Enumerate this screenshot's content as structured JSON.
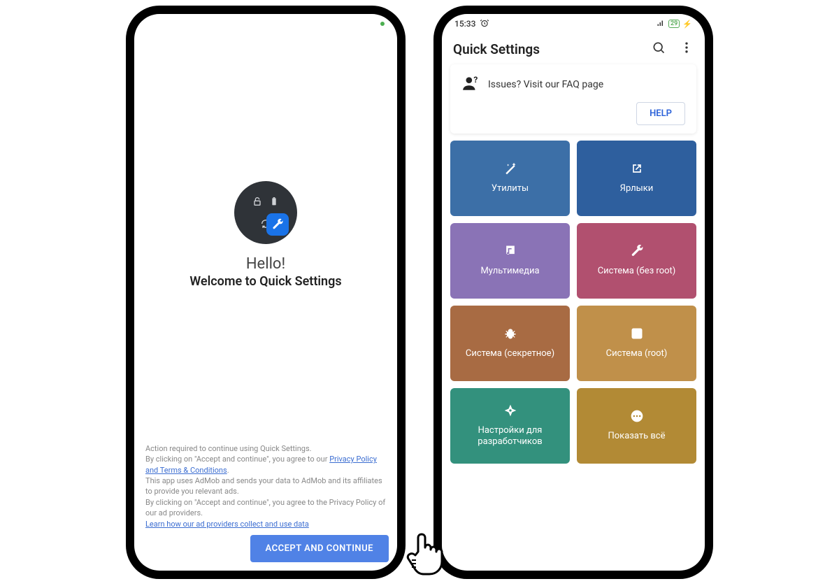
{
  "phone1": {
    "status": {
      "time": "",
      "dot_color": "#4caf50"
    },
    "hello": "Hello!",
    "subtitle": "Welcome to Quick Settings",
    "legal": {
      "line1": "Action required to continue using Quick Settings.",
      "line2a": "By clicking on \"Accept and continue\", you agree to our ",
      "privacy_link": "Privacy Policy and Terms & Conditions",
      "line2b": ".",
      "line3": "This app uses AdMob and sends your data to AdMob and its affiliates to provide you relevant ads.",
      "line4": "By clicking on \"Accept and continue\", you agree to the Privacy Policy of our ad providers.",
      "learn_link": "Learn how our ad providers collect and use data"
    },
    "accept_label": "ACCEPT AND CONTINUE"
  },
  "phone2": {
    "status": {
      "time": "15:33",
      "battery": "29"
    },
    "appbar_title": "Quick Settings",
    "faq_text": "Issues? Visit our FAQ page",
    "help_label": "HELP",
    "tiles": [
      {
        "label": "Утилиты",
        "color": "#3c6fa7",
        "icon": "wand"
      },
      {
        "label": "Ярлыки",
        "color": "#2e5f9e",
        "icon": "shortcut"
      },
      {
        "label": "Мультимедиа",
        "color": "#8a73b6",
        "icon": "music"
      },
      {
        "label": "Система (без root)",
        "color": "#b1506f",
        "icon": "wrench"
      },
      {
        "label": "Система (секретное)",
        "color": "#a86b43",
        "icon": "bug"
      },
      {
        "label": "Система (root)",
        "color": "#c0904a",
        "icon": "hash"
      },
      {
        "label": "Настройки для разработчиков",
        "color": "#33917d",
        "icon": "compass"
      },
      {
        "label": "Показать всё",
        "color": "#b28a35",
        "icon": "dots"
      }
    ]
  }
}
